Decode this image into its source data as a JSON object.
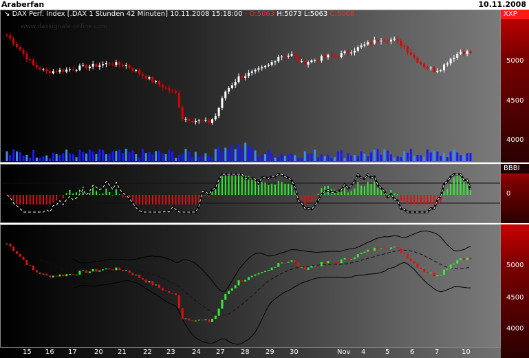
{
  "window": {
    "title": "Araberfan",
    "date": "10.11.2008"
  },
  "price_panel": {
    "arrow": "↘",
    "title": "DAX Perf. Index [.DAX  1 Stunden 42 Minuten]",
    "datetime": "10.11.2008 15:18:00",
    "open_text": "- O:5063",
    "high_text": "H:5073",
    "low_text": "L:5063",
    "close_text": "C:5068",
    "watermark": "www.daxsignale-online.com",
    "scale_label": "XXP",
    "ticks": [
      "5000",
      "4500",
      "4000"
    ]
  },
  "oscillator_panel": {
    "scale_label": "BBBI",
    "ticks": [
      "0"
    ]
  },
  "bands_panel": {
    "ticks": [
      "5000",
      "4500",
      "4000"
    ]
  },
  "colors": {
    "up": "#ffffff",
    "down": "#dd0000",
    "vol_dark": "#1a1aff",
    "vol_light": "#3a8fe8",
    "hist_up": "#33ee33",
    "hist_down": "#dd1111"
  },
  "chart_data": {
    "type": "candlestick",
    "x_axis": [
      "15",
      "16",
      "17",
      "20",
      "21",
      "22",
      "23",
      "24",
      "27",
      "28",
      "29",
      "30",
      "Nov",
      "4",
      "5",
      "6",
      "7",
      "10"
    ],
    "ylim": [
      3800,
      5450
    ],
    "close_path": [
      [
        0,
        5300
      ],
      [
        3,
        5150
      ],
      [
        8,
        4870
      ],
      [
        12,
        4780
      ],
      [
        17,
        4800
      ],
      [
        22,
        4840
      ],
      [
        27,
        4870
      ],
      [
        31,
        4900
      ],
      [
        36,
        4870
      ],
      [
        40,
        4760
      ],
      [
        44,
        4650
      ],
      [
        48,
        4540
      ],
      [
        51,
        4470
      ],
      [
        53,
        4120
      ],
      [
        57,
        4080
      ],
      [
        61,
        4060
      ],
      [
        63,
        4150
      ],
      [
        66,
        4500
      ],
      [
        70,
        4700
      ],
      [
        75,
        4780
      ],
      [
        79,
        4870
      ],
      [
        82,
        5000
      ],
      [
        86,
        5020
      ],
      [
        89,
        4900
      ],
      [
        93,
        4950
      ],
      [
        97,
        5000
      ],
      [
        100,
        5010
      ],
      [
        105,
        5100
      ],
      [
        109,
        5180
      ],
      [
        113,
        5250
      ],
      [
        117,
        5230
      ],
      [
        120,
        5140
      ],
      [
        123,
        4980
      ],
      [
        126,
        4860
      ],
      [
        129,
        4800
      ],
      [
        131,
        4830
      ],
      [
        134,
        4970
      ],
      [
        137,
        5070
      ],
      [
        140,
        5050
      ]
    ]
  }
}
